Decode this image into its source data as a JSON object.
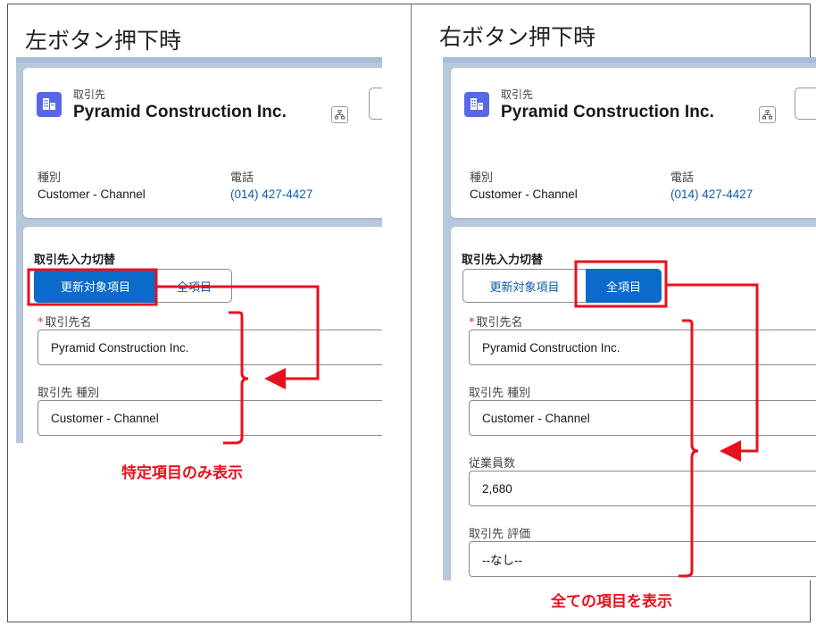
{
  "left_panel": {
    "title": "左ボタン押下時",
    "object_label": "取引先",
    "record_name": "Pyramid Construction Inc.",
    "fields": [
      {
        "label": "種別",
        "value": "Customer - Channel"
      },
      {
        "label": "電話",
        "value": "(014) 427-4427"
      }
    ],
    "section_title": "取引先入力切替",
    "toggle": {
      "left_label": "更新対象項目",
      "right_label": "全項目",
      "selected": "left"
    },
    "form": [
      {
        "label": "取引先名",
        "required": true,
        "value": "Pyramid Construction Inc."
      },
      {
        "label": "取引先 種別",
        "required": false,
        "value": "Customer - Channel"
      }
    ],
    "caption": "特定項目のみ表示"
  },
  "right_panel": {
    "title": "右ボタン押下時",
    "object_label": "取引先",
    "record_name": "Pyramid Construction Inc.",
    "fields": [
      {
        "label": "種別",
        "value": "Customer - Channel"
      },
      {
        "label": "電話",
        "value": "(014) 427-4427"
      }
    ],
    "section_title": "取引先入力切替",
    "toggle": {
      "left_label": "更新対象項目",
      "right_label": "全項目",
      "selected": "right"
    },
    "form": [
      {
        "label": "取引先名",
        "required": true,
        "value": "Pyramid Construction Inc."
      },
      {
        "label": "取引先 種別",
        "required": false,
        "value": "Customer - Channel"
      },
      {
        "label": "従業員数",
        "required": false,
        "value": "2,680"
      },
      {
        "label": "取引先 評価",
        "required": false,
        "value": "--なし--"
      }
    ],
    "caption": "全ての項目を表示"
  },
  "colors": {
    "brand_blue": "#0b6bcb",
    "annotation_red": "#e8101d",
    "record_icon": "#5867e8",
    "page_background": "#b8c8dc"
  },
  "icons": [
    "account-building-icon",
    "hierarchy-icon",
    "required-asterisk"
  ]
}
